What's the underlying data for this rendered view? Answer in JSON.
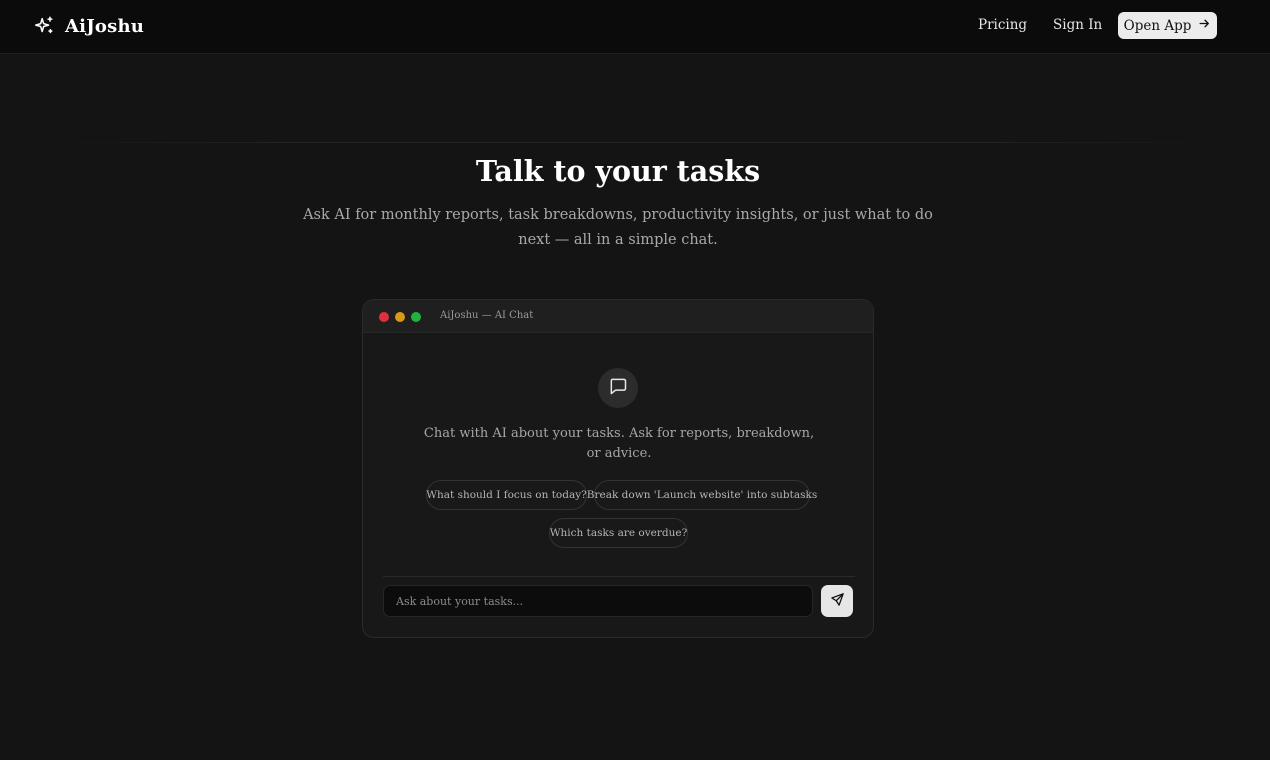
{
  "nav": {
    "brand": "AiJoshu",
    "pricing": "Pricing",
    "sign_in": "Sign In",
    "open_app": "Open App"
  },
  "hero": {
    "title": "Talk to your tasks",
    "subtitle": "Ask AI for monthly reports, task breakdowns, productivity insights, or just what to do next — all in a simple chat."
  },
  "chat_window": {
    "title": "AiJoshu — AI Chat",
    "intro": "Chat with AI about your tasks. Ask for reports, breakdown, or advice.",
    "suggestions": [
      "What should I focus on today?",
      "Break down 'Launch website' into subtasks",
      "Which tasks are overdue?"
    ],
    "input_placeholder": "Ask about your tasks..."
  },
  "icons": {
    "brand": "sparkles-icon",
    "open_app": "arrow-right-icon",
    "chat": "message-square-icon",
    "send": "send-icon"
  },
  "colors": {
    "background": "#141414",
    "topbar": "#0b0b0b",
    "button_bg": "#ececec",
    "dot_red": "#e0303c",
    "dot_yellow": "#d99a1a",
    "dot_green": "#21b33a"
  }
}
